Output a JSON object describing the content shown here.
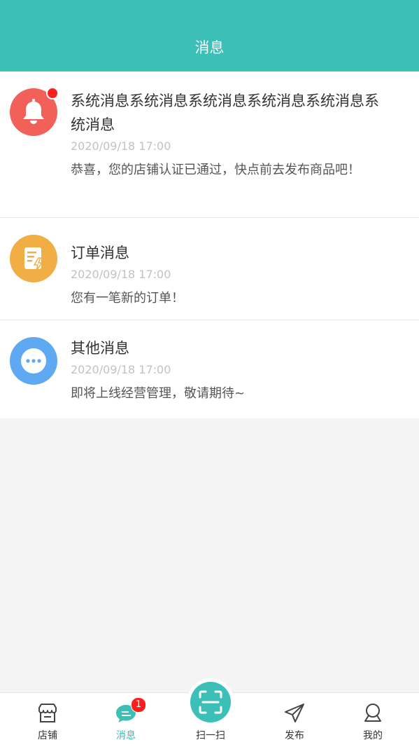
{
  "header": {
    "title": "消息"
  },
  "messages": [
    {
      "icon": "bell-icon",
      "color": "#f2605a",
      "title": "系统消息系统消息系统消息系统消息系统消息系统消息",
      "time": "2020/09/18 17:00",
      "body": "恭喜，您的店铺认证已通过，快点前去发布商品吧！",
      "unread": true
    },
    {
      "icon": "order-icon",
      "color": "#f1ae45",
      "title": "订单消息",
      "time": "2020/09/18 17:00",
      "body": "您有一笔新的订单！",
      "unread": false
    },
    {
      "icon": "more-dots-icon",
      "color": "#5fa8f2",
      "title": "其他消息",
      "time": "2020/09/18 17:00",
      "body": "即将上线经营管理，敬请期待~",
      "unread": false
    }
  ],
  "tabbar": {
    "accent": "#3bbfb7",
    "items": [
      {
        "label": "店铺",
        "icon": "store-icon"
      },
      {
        "label": "消息",
        "icon": "message-icon",
        "badge": "1",
        "active": true
      },
      {
        "label": "扫一扫",
        "icon": "scan-icon"
      },
      {
        "label": "发布",
        "icon": "send-icon"
      },
      {
        "label": "我的",
        "icon": "profile-icon"
      }
    ]
  }
}
